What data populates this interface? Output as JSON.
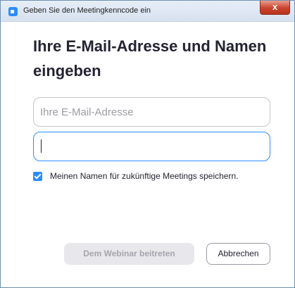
{
  "window": {
    "title": "Geben Sie den Meetingkenncode ein",
    "close_label": "x"
  },
  "main": {
    "heading": "Ihre E-Mail-Adresse und Namen eingeben",
    "email_field": {
      "placeholder": "Ihre E-Mail-Adresse",
      "value": ""
    },
    "name_field": {
      "placeholder": "",
      "value": ""
    },
    "remember_checkbox": {
      "checked": true,
      "label": "Meinen Namen für zukünftige Meetings speichern."
    }
  },
  "buttons": {
    "join_label": "Dem Webinar beitreten",
    "cancel_label": "Abbrechen"
  },
  "colors": {
    "accent": "#2d8cff",
    "close": "#c9432d"
  },
  "icons": {
    "app": "zoom-app-icon",
    "close": "close-icon",
    "check": "checkmark-icon"
  }
}
